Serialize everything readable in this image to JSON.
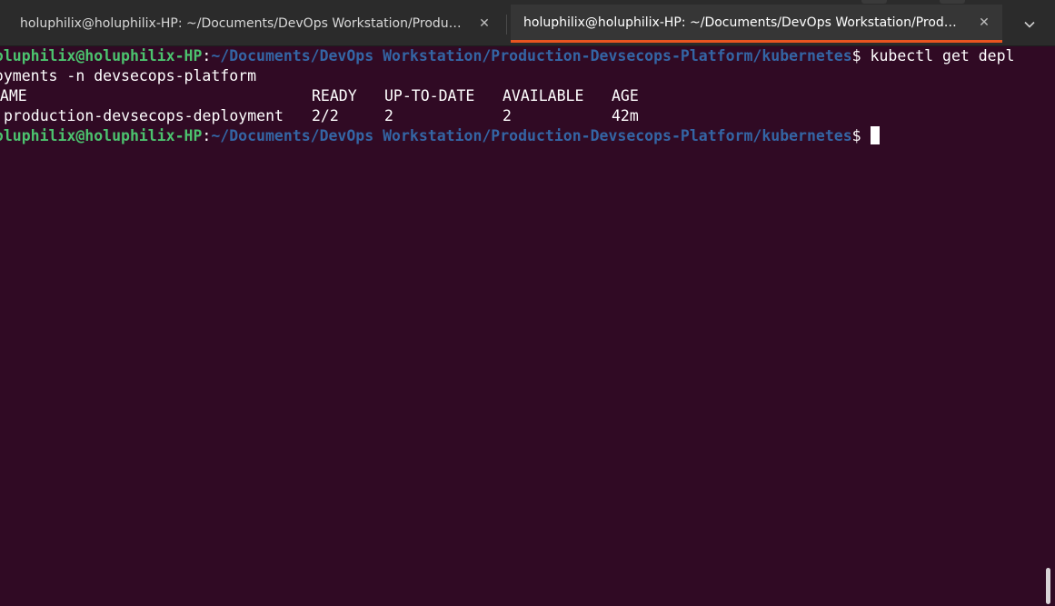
{
  "tabs": [
    {
      "title": "holuphilix@holuphilix-HP: ~/Documents/DevOps Workstation/Productio…",
      "active": false
    },
    {
      "title": "holuphilix@holuphilix-HP: ~/Documents/DevOps Workstation/Productio…",
      "active": true
    }
  ],
  "icons": {
    "tab_close": "close-icon",
    "menu": "chevron-down-icon"
  },
  "colors": {
    "background": "#300a24",
    "prompt_user": "#4cc26e",
    "prompt_path": "#3465a4",
    "active_tab_accent": "#e95420"
  },
  "terminal": {
    "prompt": {
      "user_host": "holuphilix@holuphilix-HP",
      "separator": ":",
      "path": "~/Documents/DevOps Workstation/Production-Devsecops-Platform/kubernetes",
      "dollar": "$"
    },
    "command_line1": " kubectl get depl",
    "command_line2": "loyments -n devsecops-platform",
    "table": {
      "headers": [
        "NAME",
        "READY",
        "UP-TO-DATE",
        "AVAILABLE",
        "AGE"
      ],
      "rows": [
        [
          "production-devsecops-deployment",
          "2/2",
          "2",
          "2",
          "42m"
        ]
      ]
    }
  }
}
